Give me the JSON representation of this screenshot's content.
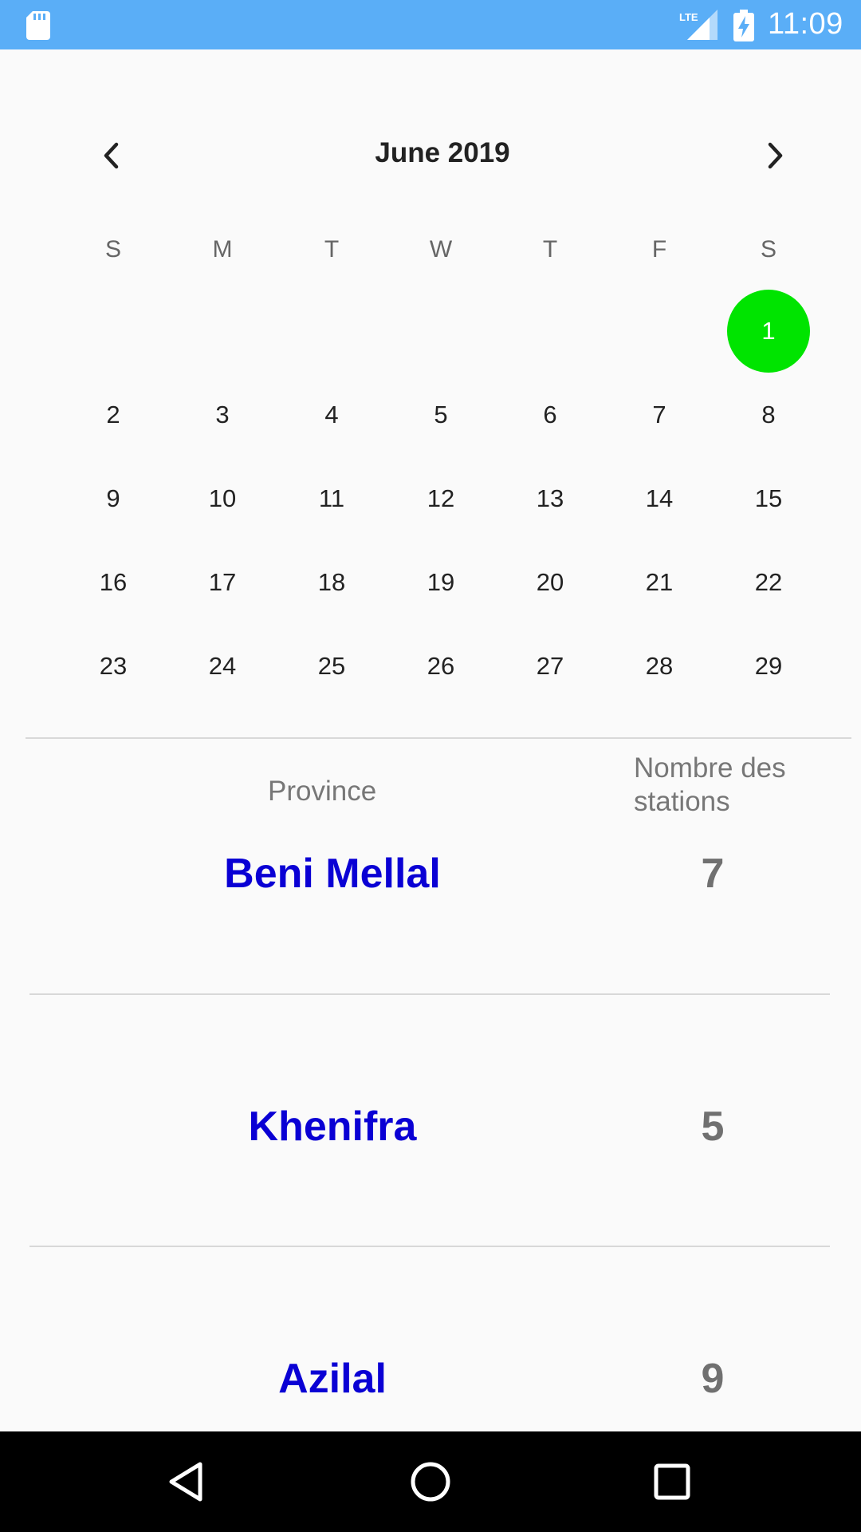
{
  "status_bar": {
    "time": "11:09",
    "network": "LTE",
    "icons": [
      "sd-card-icon",
      "lte-signal-icon",
      "battery-charging-icon"
    ]
  },
  "calendar": {
    "month_label": "June 2019",
    "weekdays": [
      "S",
      "M",
      "T",
      "W",
      "T",
      "F",
      "S"
    ],
    "days": [
      "1",
      "2",
      "3",
      "4",
      "5",
      "6",
      "7",
      "8",
      "9",
      "10",
      "11",
      "12",
      "13",
      "14",
      "15",
      "16",
      "17",
      "18",
      "19",
      "20",
      "21",
      "22",
      "23",
      "24",
      "25",
      "26",
      "27",
      "28",
      "29"
    ],
    "selected_day": "1",
    "selected_color": "#00e400"
  },
  "table": {
    "col_province": "Province",
    "col_count_line1": "Nombre des",
    "col_count_line2": "stations",
    "province_color": "#0a00d4",
    "rows": [
      {
        "province": "Beni Mellal",
        "count": "7"
      },
      {
        "province": "Khenifra",
        "count": "5"
      },
      {
        "province": "Azilal",
        "count": "9"
      }
    ]
  },
  "nav_bar": {
    "buttons": [
      "back-icon",
      "home-icon",
      "recents-icon"
    ]
  }
}
